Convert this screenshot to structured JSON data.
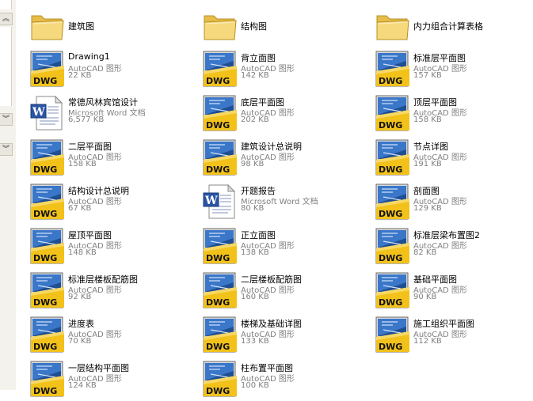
{
  "pane": {
    "buttons": [
      {
        "glyph": "︽",
        "icon": "chevron-up-double-icon"
      },
      {
        "glyph": "︾",
        "icon": "chevron-down-double-icon"
      },
      {
        "glyph": "︾",
        "icon": "chevron-down-double-icon"
      }
    ]
  },
  "columns": [
    [
      {
        "kind": "folder",
        "name": "建筑图"
      },
      {
        "kind": "dwg",
        "name": "Drawing1",
        "type": "AutoCAD 图形",
        "size": "22 KB"
      },
      {
        "kind": "doc",
        "name": "常德风林宾馆设计",
        "type": "Microsoft Word 文档",
        "size": "6,577 KB"
      },
      {
        "kind": "dwg",
        "name": "二层平面图",
        "type": "AutoCAD 图形",
        "size": "158 KB"
      },
      {
        "kind": "dwg",
        "name": "结构设计总说明",
        "type": "AutoCAD 图形",
        "size": "67 KB"
      },
      {
        "kind": "dwg",
        "name": "屋顶平面图",
        "type": "AutoCAD 图形",
        "size": "148 KB"
      },
      {
        "kind": "dwg",
        "name": "标准层楼板配筋图",
        "type": "AutoCAD 图形",
        "size": "92 KB"
      },
      {
        "kind": "dwg",
        "name": "进度表",
        "type": "AutoCAD 图形",
        "size": "70 KB"
      },
      {
        "kind": "dwg",
        "name": "一层结构平面图",
        "type": "AutoCAD 图形",
        "size": "124 KB"
      }
    ],
    [
      {
        "kind": "folder",
        "name": "结构图"
      },
      {
        "kind": "dwg",
        "name": "背立面图",
        "type": "AutoCAD 图形",
        "size": "142 KB"
      },
      {
        "kind": "dwg",
        "name": "底层平面图",
        "type": "AutoCAD 图形",
        "size": "202 KB"
      },
      {
        "kind": "dwg",
        "name": "建筑设计总说明",
        "type": "AutoCAD 图形",
        "size": "98 KB"
      },
      {
        "kind": "doc",
        "name": "开题报告",
        "type": "Microsoft Word 文档",
        "size": "80 KB"
      },
      {
        "kind": "dwg",
        "name": "正立面图",
        "type": "AutoCAD 图形",
        "size": "138 KB"
      },
      {
        "kind": "dwg",
        "name": "二层楼板配筋图",
        "type": "AutoCAD 图形",
        "size": "160 KB"
      },
      {
        "kind": "dwg",
        "name": "楼梯及基础详图",
        "type": "AutoCAD 图形",
        "size": "133 KB"
      },
      {
        "kind": "dwg",
        "name": "柱布置平面图",
        "type": "AutoCAD 图形",
        "size": "100 KB"
      }
    ],
    [
      {
        "kind": "folder",
        "name": "内力组合计算表格"
      },
      {
        "kind": "dwg",
        "name": "标准层平面图",
        "type": "AutoCAD 图形",
        "size": "157 KB"
      },
      {
        "kind": "dwg",
        "name": "顶层平面图",
        "type": "AutoCAD 图形",
        "size": "158 KB"
      },
      {
        "kind": "dwg",
        "name": "节点详图",
        "type": "AutoCAD 图形",
        "size": "191 KB"
      },
      {
        "kind": "dwg",
        "name": "剖面图",
        "type": "AutoCAD 图形",
        "size": "129 KB"
      },
      {
        "kind": "dwg",
        "name": "标准层梁布置图2",
        "type": "AutoCAD 图形",
        "size": "82 KB"
      },
      {
        "kind": "dwg",
        "name": "基础平面图",
        "type": "AutoCAD 图形",
        "size": "90 KB"
      },
      {
        "kind": "dwg",
        "name": "施工组织平面图",
        "type": "AutoCAD 图形",
        "size": "112 KB"
      }
    ]
  ],
  "colors": {
    "dwg_yellow": "#f2c21b",
    "dwg_blue": "#1f4e93",
    "folder": "#f5d77a",
    "text_secondary": "#808080"
  }
}
